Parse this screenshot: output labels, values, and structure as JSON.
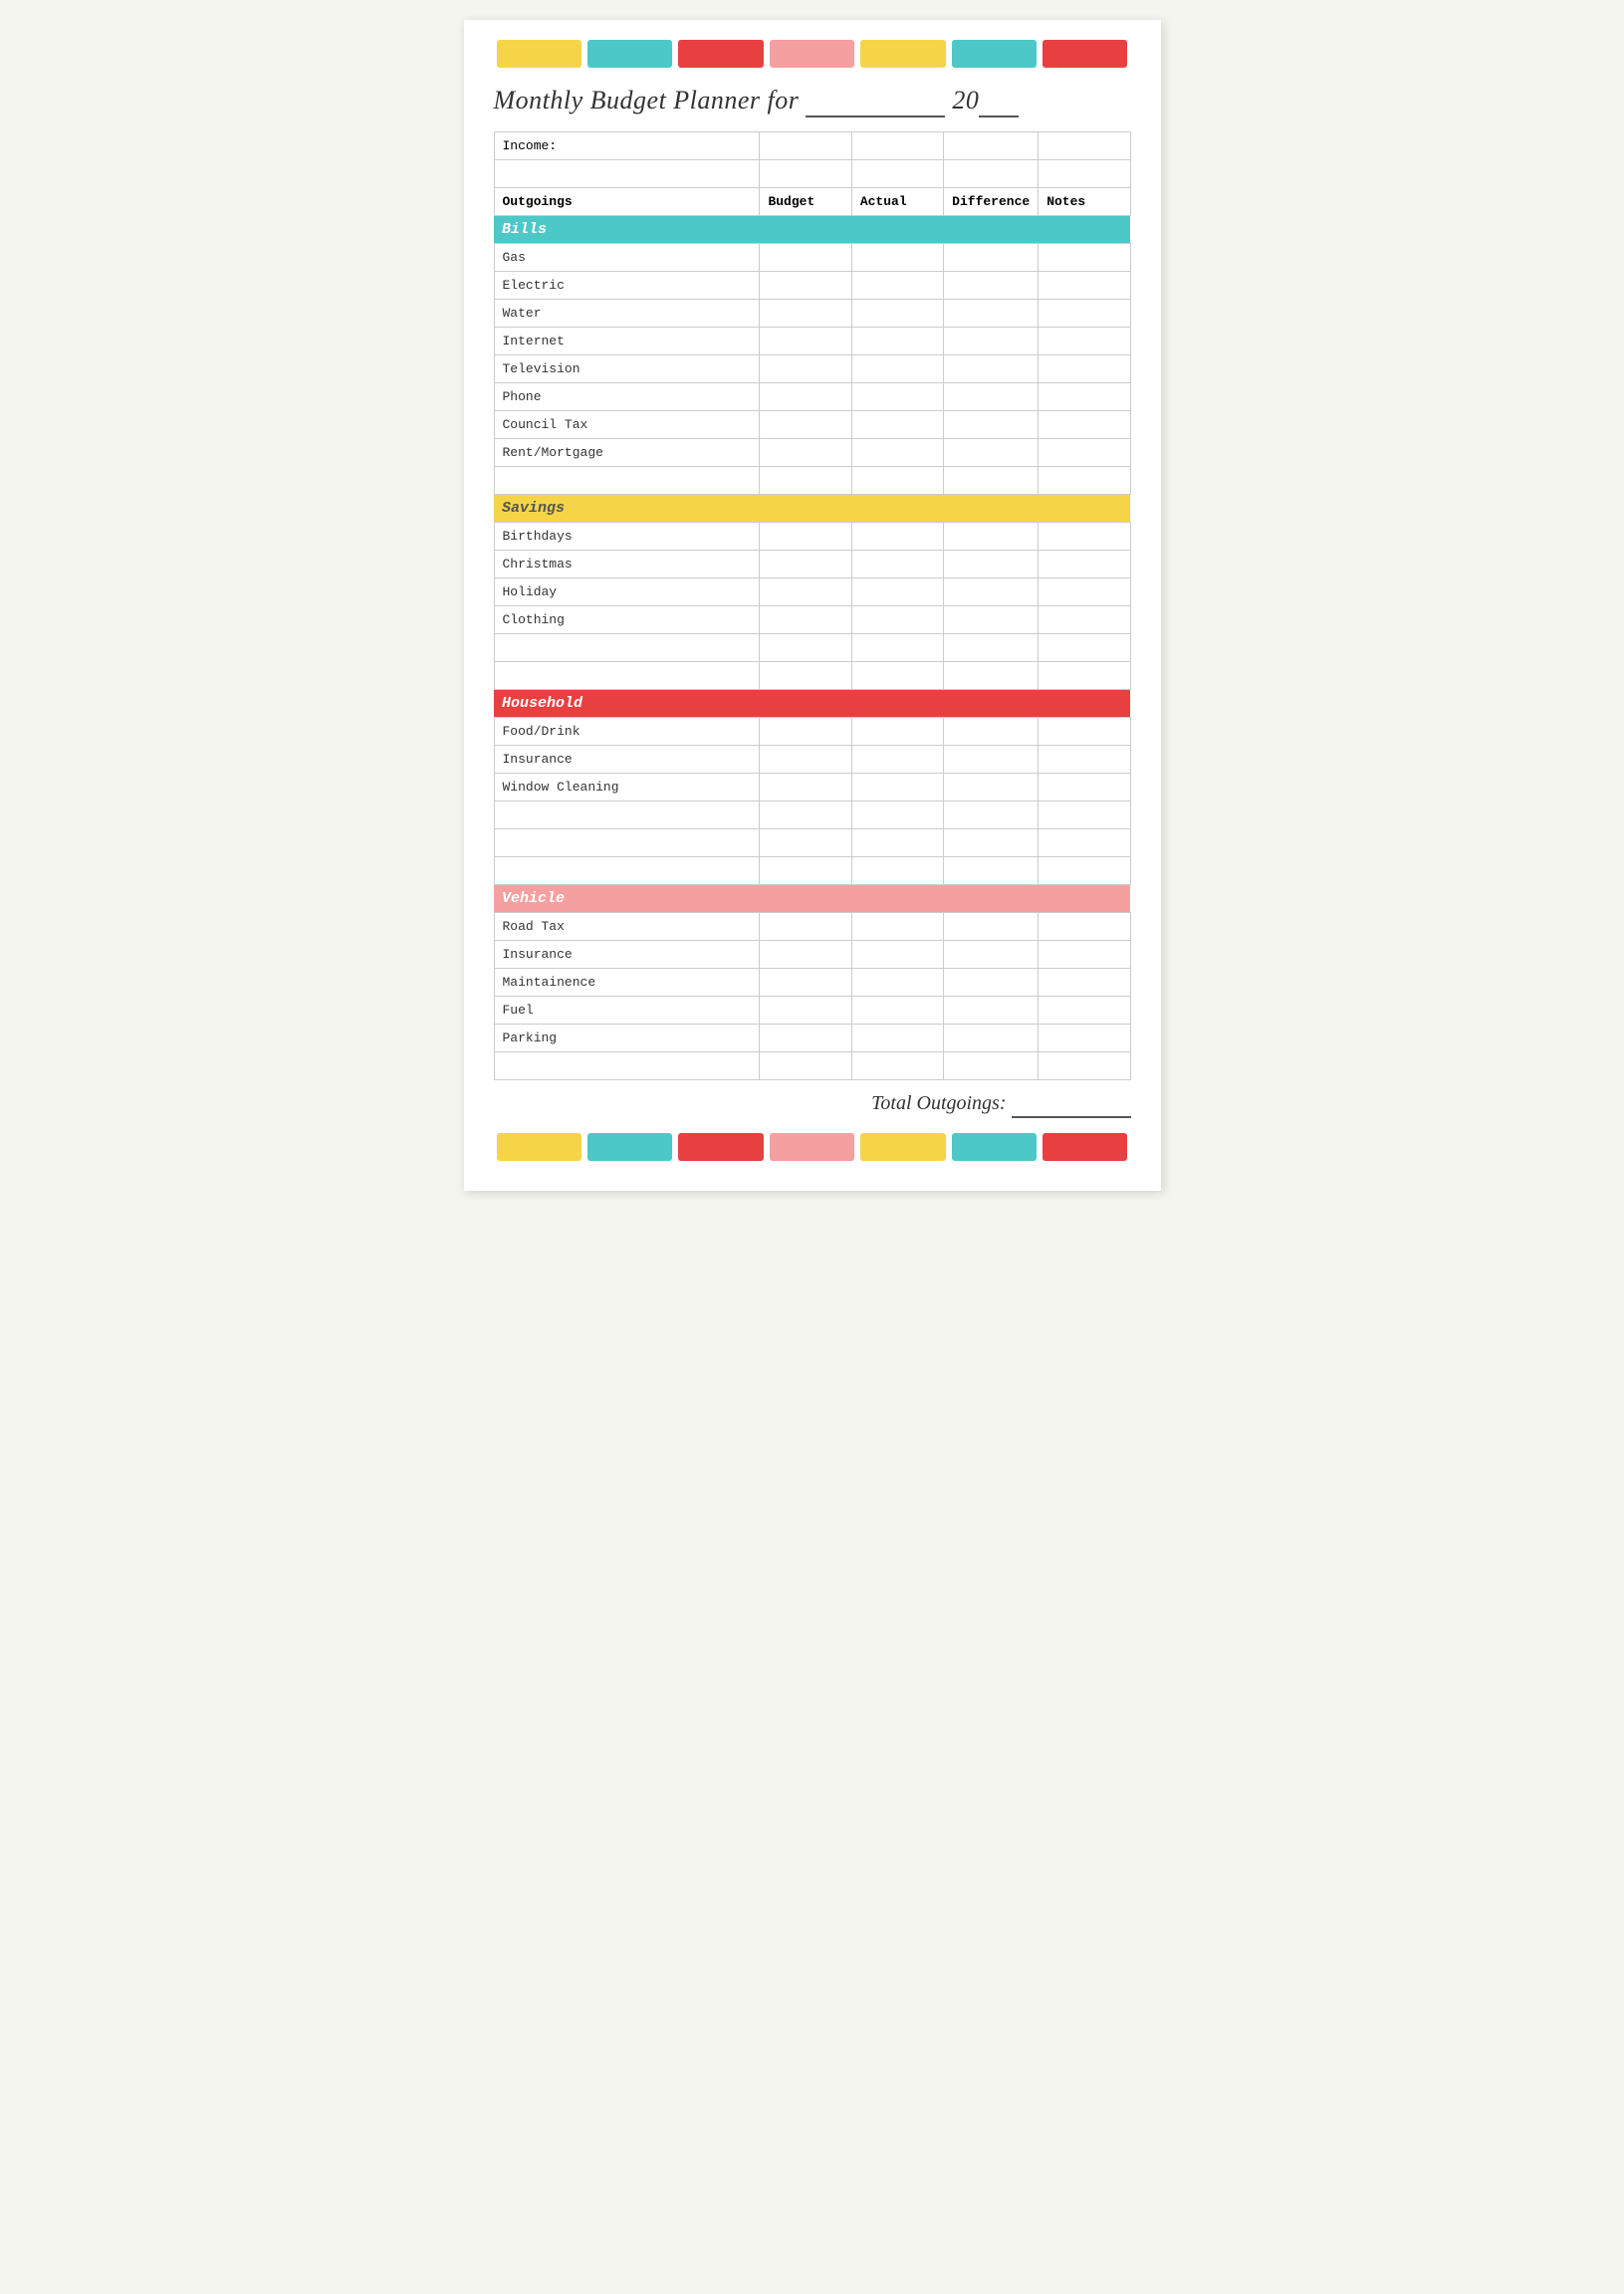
{
  "title": {
    "text": "Monthly Budget Planner for",
    "suffix": "20",
    "line_placeholder": "___________",
    "year_line": "__"
  },
  "color_bars": [
    "yellow",
    "teal",
    "red",
    "pink",
    "yellow",
    "teal",
    "red"
  ],
  "table": {
    "income_label": "Income:",
    "columns": {
      "outgoings": "Outgoings",
      "budget": "Budget",
      "actual": "Actual",
      "difference": "Difference",
      "notes": "Notes"
    },
    "sections": [
      {
        "category": "Bills",
        "color": "teal",
        "items": [
          "Gas",
          "Electric",
          "Water",
          "Internet",
          "Television",
          "Phone",
          "Council Tax",
          "Rent/Mortgage"
        ],
        "extra_empty": 1
      },
      {
        "category": "Savings",
        "color": "yellow",
        "items": [
          "Birthdays",
          "Christmas",
          "Holiday",
          "Clothing"
        ],
        "extra_empty": 2
      },
      {
        "category": "Household",
        "color": "red",
        "items": [
          "Food/Drink",
          "Insurance",
          "Window Cleaning"
        ],
        "extra_empty": 3
      },
      {
        "category": "Vehicle",
        "color": "pink",
        "items": [
          "Road Tax",
          "Insurance",
          "Maintainence",
          "Fuel",
          "Parking"
        ],
        "extra_empty": 1
      }
    ]
  },
  "total": {
    "label": "Total Outgoings:",
    "line": "_____"
  }
}
